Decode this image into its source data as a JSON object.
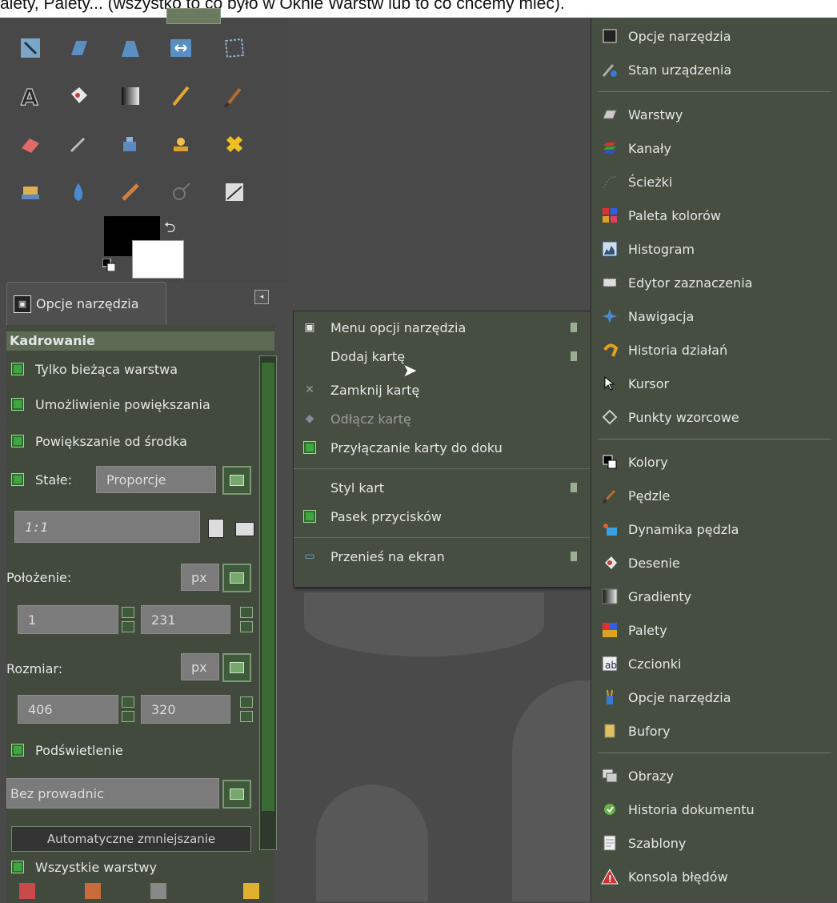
{
  "caption": "alety, Palety... (wszystko to co było w Oknie Warstw lub to co chcemy mieć).",
  "dock_tab": {
    "label": "Opcje narzędzia"
  },
  "tool_options": {
    "header": "Kadrowanie",
    "current_layer_only": "Tylko bieżąca warstwa",
    "allow_growing": "Umożliwienie powiększania",
    "expand_from_center": "Powiększanie od środka",
    "fixed_label": "Stałe:",
    "fixed_value": "Proporcje",
    "ratio_value": "1:1",
    "position_label": "Położenie:",
    "position_unit": "px",
    "position_x": "1",
    "position_y": "231",
    "size_label": "Rozmiar:",
    "size_unit": "px",
    "size_w": "406",
    "size_h": "320",
    "highlight": "Podświetlenie",
    "guides_value": "Bez prowadnic",
    "auto_shrink": "Automatyczne zmniejszanie",
    "all_layers": "Wszystkie warstwy"
  },
  "context_menu": {
    "items": [
      {
        "label": "Menu opcji narzędzia",
        "icon": "tool-options-icon",
        "submenu": true
      },
      {
        "label": "Dodaj kartę",
        "icon": "",
        "submenu": true
      },
      {
        "label": "Zamknij kartę",
        "icon": "close-icon",
        "submenu": false
      },
      {
        "label": "Odłącz kartę",
        "icon": "detach-icon",
        "submenu": false,
        "disabled": true
      },
      {
        "label": "Przyłączanie karty do doku",
        "icon": "checkbox-icon",
        "submenu": false
      },
      {
        "label": "Styl kart",
        "icon": "",
        "submenu": true
      },
      {
        "label": "Pasek przycisków",
        "icon": "checkbox-icon",
        "submenu": false
      },
      {
        "label": "Przenieś na ekran",
        "icon": "monitor-icon",
        "submenu": true
      }
    ]
  },
  "right_menu": {
    "items": [
      {
        "label": "Opcje narzędzia",
        "icon": "tool-options-icon"
      },
      {
        "label": "Stan urządzenia",
        "icon": "device-status-icon"
      },
      {
        "label": "Warstwy",
        "icon": "layers-icon"
      },
      {
        "label": "Kanały",
        "icon": "channels-icon"
      },
      {
        "label": "Ścieżki",
        "icon": "paths-icon"
      },
      {
        "label": "Paleta kolorów",
        "icon": "colormap-icon"
      },
      {
        "label": "Histogram",
        "icon": "histogram-icon"
      },
      {
        "label": "Edytor zaznaczenia",
        "icon": "selection-editor-icon"
      },
      {
        "label": "Nawigacja",
        "icon": "navigation-icon"
      },
      {
        "label": "Historia działań",
        "icon": "undo-history-icon"
      },
      {
        "label": "Kursor",
        "icon": "pointer-icon"
      },
      {
        "label": "Punkty wzorcowe",
        "icon": "sample-points-icon"
      },
      {
        "label": "Kolory",
        "icon": "colors-icon"
      },
      {
        "label": "Pędzle",
        "icon": "brushes-icon"
      },
      {
        "label": "Dynamika pędzla",
        "icon": "paint-dynamics-icon"
      },
      {
        "label": "Desenie",
        "icon": "patterns-icon"
      },
      {
        "label": "Gradienty",
        "icon": "gradients-icon"
      },
      {
        "label": "Palety",
        "icon": "palettes-icon"
      },
      {
        "label": "Czcionki",
        "icon": "fonts-icon"
      },
      {
        "label": "Opcje narzędzia",
        "icon": "tool-presets-icon"
      },
      {
        "label": "Bufory",
        "icon": "buffers-icon"
      },
      {
        "label": "Obrazy",
        "icon": "images-icon"
      },
      {
        "label": "Historia dokumentu",
        "icon": "document-history-icon"
      },
      {
        "label": "Szablony",
        "icon": "templates-icon"
      },
      {
        "label": "Konsola błędów",
        "icon": "error-console-icon"
      }
    ]
  }
}
